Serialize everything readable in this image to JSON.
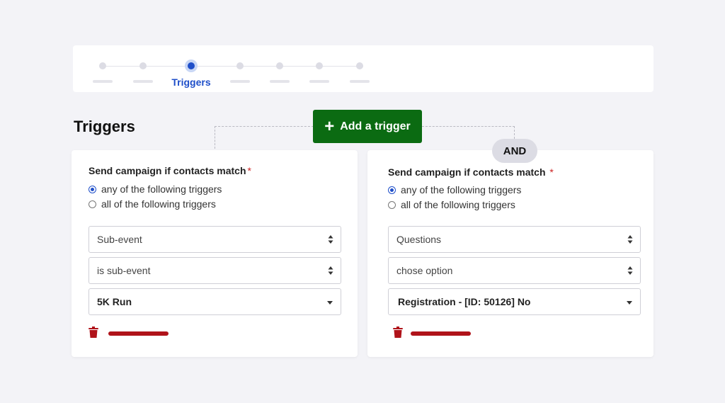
{
  "stepper": {
    "steps": [
      {
        "label": "",
        "active": false
      },
      {
        "label": "",
        "active": false
      },
      {
        "label": "Triggers",
        "active": true
      },
      {
        "label": "",
        "active": false
      },
      {
        "label": "",
        "active": false
      },
      {
        "label": "",
        "active": false
      },
      {
        "label": "",
        "active": false
      }
    ]
  },
  "page": {
    "title": "Triggers"
  },
  "toolbar": {
    "add_trigger_label": "Add a trigger",
    "and_label": "AND"
  },
  "colors": {
    "accent": "#1f4fc9",
    "button_green": "#0b6b12",
    "danger": "#b0131a"
  },
  "cards": [
    {
      "match_label": "Send campaign if contacts match",
      "required_mark": "*",
      "options": [
        "any of the following triggers",
        "all of the following triggers"
      ],
      "selected_option": 0,
      "field1": "Sub-event",
      "field2": "is sub-event",
      "field3": "5K Run"
    },
    {
      "match_label": "Send campaign if contacts match",
      "required_mark": "*",
      "options": [
        "any of the following triggers",
        "all of the following triggers"
      ],
      "selected_option": 0,
      "field1": "Questions",
      "field2": "chose option",
      "field3": "Registration - [ID: 50126] No"
    }
  ]
}
